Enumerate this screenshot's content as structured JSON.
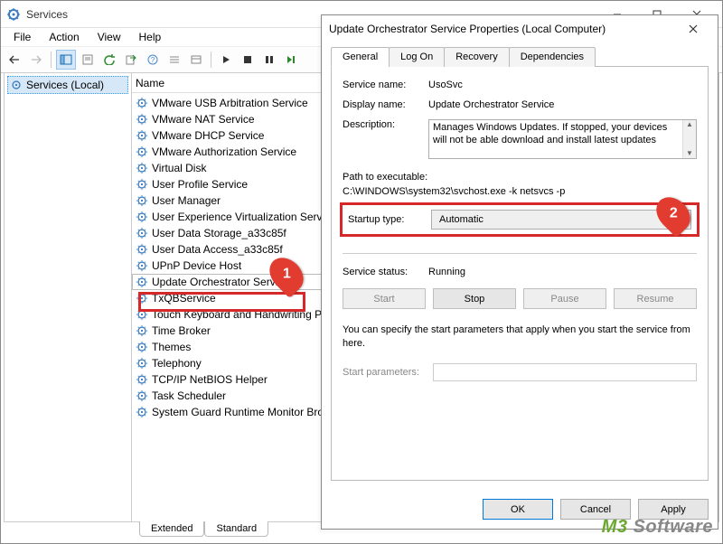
{
  "window": {
    "title": "Services",
    "menu": [
      "File",
      "Action",
      "View",
      "Help"
    ],
    "tree_root": "Services (Local)",
    "tabs": {
      "extended": "Extended",
      "standard": "Standard"
    },
    "list_header": "Name"
  },
  "services": [
    "VMware USB Arbitration Service",
    "VMware NAT Service",
    "VMware DHCP Service",
    "VMware Authorization Service",
    "Virtual Disk",
    "User Profile Service",
    "User Manager",
    "User Experience Virtualization Service",
    "User Data Storage_a33c85f",
    "User Data Access_a33c85f",
    "UPnP Device Host",
    "Update Orchestrator Service",
    "TxQBService",
    "Touch Keyboard and Handwriting Panel Service",
    "Time Broker",
    "Themes",
    "Telephony",
    "TCP/IP NetBIOS Helper",
    "Task Scheduler",
    "System Guard Runtime Monitor Broker"
  ],
  "selected_index": 11,
  "dialog": {
    "title": "Update Orchestrator Service Properties (Local Computer)",
    "tabs": [
      "General",
      "Log On",
      "Recovery",
      "Dependencies"
    ],
    "labels": {
      "service_name": "Service name:",
      "display_name": "Display name:",
      "description": "Description:",
      "path_exec": "Path to executable:",
      "startup_type": "Startup type:",
      "service_status": "Service status:",
      "start_params": "Start parameters:"
    },
    "values": {
      "service_name": "UsoSvc",
      "display_name": "Update Orchestrator Service",
      "description": "Manages Windows Updates. If stopped, your devices will not be able download and install latest updates",
      "path_exec": "C:\\WINDOWS\\system32\\svchost.exe -k netsvcs -p",
      "startup_type": "Automatic",
      "service_status": "Running"
    },
    "buttons": {
      "start": "Start",
      "stop": "Stop",
      "pause": "Pause",
      "resume": "Resume",
      "ok": "OK",
      "cancel": "Cancel",
      "apply": "Apply"
    },
    "explain": "You can specify the start parameters that apply when you start the service from here."
  },
  "annotations": {
    "m1": "1",
    "m2": "2"
  },
  "watermark": {
    "brand": "M3",
    "text": " Software"
  }
}
